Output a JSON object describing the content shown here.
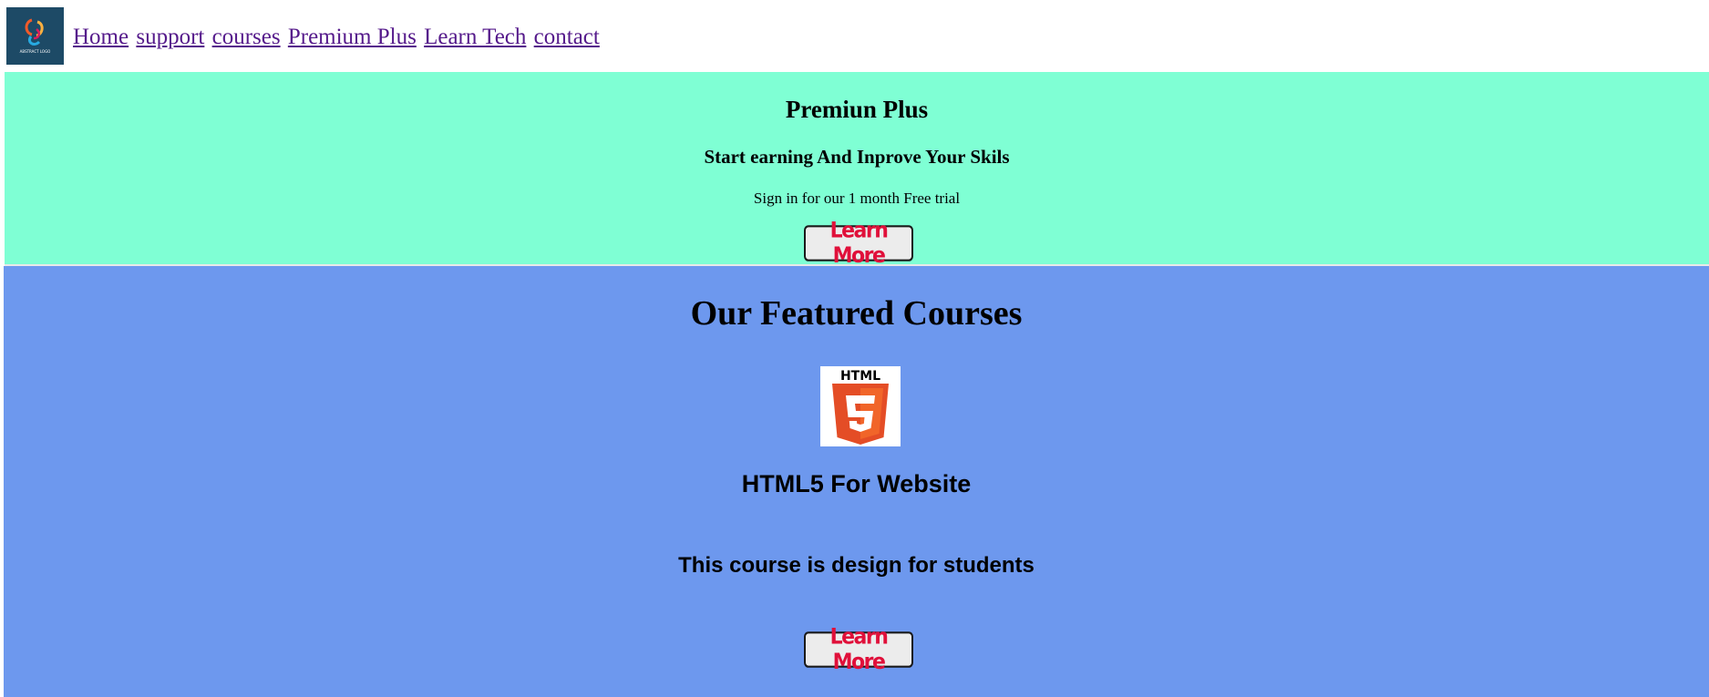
{
  "header": {
    "logo_text": "ABSTRACT LOGO",
    "nav": [
      {
        "label": "Home"
      },
      {
        "label": "support"
      },
      {
        "label": "courses"
      },
      {
        "label": "Premium Plus"
      },
      {
        "label": "Learn Tech"
      },
      {
        "label": "contact"
      }
    ]
  },
  "premium": {
    "title": "Premiun Plus",
    "subtitle": "Start earning And Inprove Your Skils",
    "text": "Sign in for our 1 month Free trial",
    "button_label": "Learn More"
  },
  "featured": {
    "title": "Our Featured Courses",
    "course": {
      "logo_text": "HTML",
      "title": "HTML5 For Website",
      "description": "This course is design for students",
      "button_label": "Learn More"
    }
  },
  "colors": {
    "premium_bg": "#7fffd4",
    "featured_bg": "#6d98ee",
    "link": "#551a8b",
    "button_text": "#e0103a",
    "html5_orange": "#e44d26"
  },
  "icons": {
    "logo": "abstract-logo-icon",
    "course": "html5-logo-icon"
  }
}
